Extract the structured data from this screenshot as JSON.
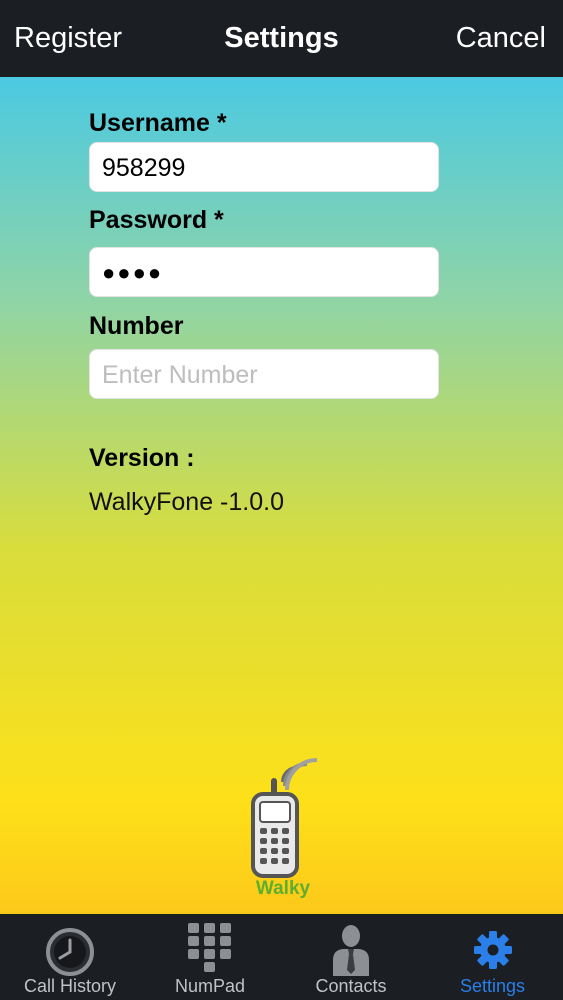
{
  "navbar": {
    "left": "Register",
    "title": "Settings",
    "right": "Cancel"
  },
  "form": {
    "username_label": "Username *",
    "username_value": "958299",
    "password_label": "Password *",
    "password_mask": "●●●●",
    "number_label": "Number",
    "number_placeholder": "Enter Number"
  },
  "version": {
    "label": "Version :",
    "value": "WalkyFone -1.0.0"
  },
  "logo": {
    "text": "Walky"
  },
  "tabs": [
    {
      "label": "Call History",
      "icon": "clock-icon"
    },
    {
      "label": "NumPad",
      "icon": "keypad-icon"
    },
    {
      "label": "Contacts",
      "icon": "contact-person-icon"
    },
    {
      "label": "Settings",
      "icon": "gear-icon"
    }
  ],
  "colors": {
    "active_tab": "#2a7fe8",
    "bar": "#1b1e22",
    "logo_green": "#5fae2e"
  }
}
